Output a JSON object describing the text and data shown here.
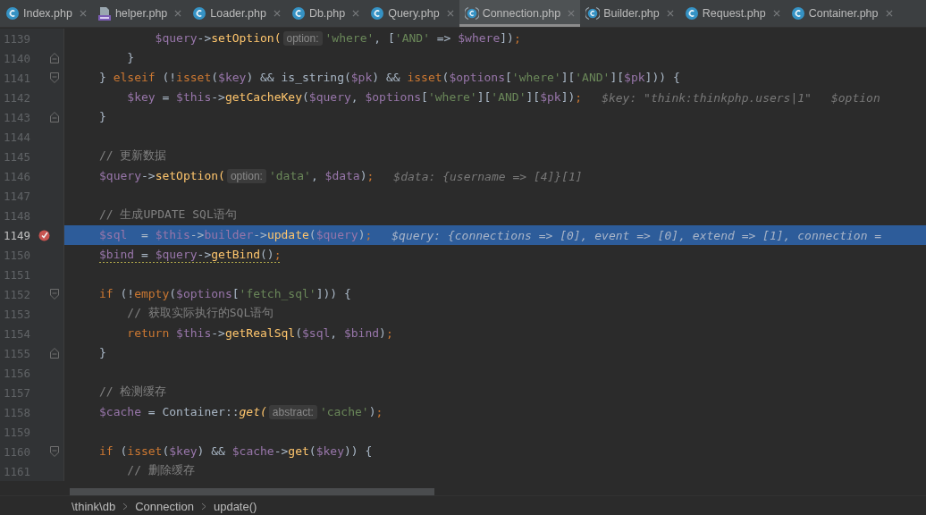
{
  "tabs": [
    {
      "label": "Index.php",
      "kind": "class",
      "selected": false
    },
    {
      "label": "helper.php",
      "kind": "php",
      "selected": false
    },
    {
      "label": "Loader.php",
      "kind": "class",
      "selected": false
    },
    {
      "label": "Db.php",
      "kind": "class",
      "selected": false
    },
    {
      "label": "Query.php",
      "kind": "class",
      "selected": false
    },
    {
      "label": "Connection.php",
      "kind": "class-bracketed",
      "selected": true
    },
    {
      "label": "Builder.php",
      "kind": "class-bracketed",
      "selected": false
    },
    {
      "label": "Request.php",
      "kind": "class",
      "selected": false
    },
    {
      "label": "Container.php",
      "kind": "class",
      "selected": false
    }
  ],
  "lines": [
    {
      "number": "1139",
      "breakpoint": false,
      "current": false,
      "segments": [
        {
          "kind": "code",
          "underline": false,
          "tokens": [
            {
              "kind": "var",
              "text": "        $query"
            },
            {
              "kind": "plain",
              "text": "->"
            },
            {
              "kind": "func",
              "text": "setOption("
            }
          ]
        },
        {
          "kind": "hint",
          "text": "option:"
        },
        {
          "kind": "code",
          "underline": false,
          "tokens": [
            {
              "kind": "string",
              "text": "'where'"
            },
            {
              "kind": "plain",
              "text": ", ["
            },
            {
              "kind": "string",
              "text": "'AND'"
            },
            {
              "kind": "plain",
              "text": " => "
            },
            {
              "kind": "var",
              "text": "$where"
            },
            {
              "kind": "plain",
              "text": "])"
            },
            {
              "kind": "keyword",
              "text": ";"
            }
          ]
        }
      ]
    },
    {
      "number": "1140",
      "fold": {
        "kind": "end"
      },
      "breakpoint": false,
      "current": false,
      "segments": [
        {
          "kind": "code",
          "underline": false,
          "tokens": [
            {
              "kind": "plain",
              "text": "    }"
            }
          ]
        }
      ]
    },
    {
      "number": "1141",
      "fold": {
        "kind": "start"
      },
      "breakpoint": false,
      "current": false,
      "segments": [
        {
          "kind": "code",
          "underline": false,
          "tokens": [
            {
              "kind": "plain",
              "text": "} "
            },
            {
              "kind": "keyword",
              "text": "elseif "
            },
            {
              "kind": "plain",
              "text": "(!"
            },
            {
              "kind": "keyword",
              "text": "isset"
            },
            {
              "kind": "plain",
              "text": "("
            },
            {
              "kind": "var",
              "text": "$key"
            },
            {
              "kind": "plain",
              "text": ") && is_string("
            },
            {
              "kind": "var",
              "text": "$pk"
            },
            {
              "kind": "plain",
              "text": ") && "
            },
            {
              "kind": "keyword",
              "text": "isset"
            },
            {
              "kind": "plain",
              "text": "("
            },
            {
              "kind": "var",
              "text": "$options"
            },
            {
              "kind": "plain",
              "text": "["
            },
            {
              "kind": "string",
              "text": "'where'"
            },
            {
              "kind": "plain",
              "text": "]["
            },
            {
              "kind": "string",
              "text": "'AND'"
            },
            {
              "kind": "plain",
              "text": "]["
            },
            {
              "kind": "var",
              "text": "$pk"
            },
            {
              "kind": "plain",
              "text": "])) {"
            }
          ]
        }
      ]
    },
    {
      "number": "1142",
      "breakpoint": false,
      "current": false,
      "segments": [
        {
          "kind": "code",
          "underline": false,
          "tokens": [
            {
              "kind": "var",
              "text": "    $key"
            },
            {
              "kind": "plain",
              "text": " = "
            },
            {
              "kind": "var",
              "text": "$this"
            },
            {
              "kind": "plain",
              "text": "->"
            },
            {
              "kind": "func",
              "text": "getCacheKey"
            },
            {
              "kind": "plain",
              "text": "("
            },
            {
              "kind": "var",
              "text": "$query"
            },
            {
              "kind": "plain",
              "text": ", "
            },
            {
              "kind": "var",
              "text": "$options"
            },
            {
              "kind": "plain",
              "text": "["
            },
            {
              "kind": "string",
              "text": "'where'"
            },
            {
              "kind": "plain",
              "text": "]["
            },
            {
              "kind": "string",
              "text": "'AND'"
            },
            {
              "kind": "plain",
              "text": "]["
            },
            {
              "kind": "var",
              "text": "$pk"
            },
            {
              "kind": "plain",
              "text": "])"
            },
            {
              "kind": "keyword",
              "text": ";"
            }
          ]
        },
        {
          "kind": "value",
          "text": "$key: \"think:thinkphp.users|1\""
        },
        {
          "kind": "value",
          "text": "$option"
        }
      ]
    },
    {
      "number": "1143",
      "fold": {
        "kind": "end"
      },
      "breakpoint": false,
      "current": false,
      "segments": [
        {
          "kind": "code",
          "underline": false,
          "tokens": [
            {
              "kind": "plain",
              "text": "}"
            }
          ]
        }
      ]
    },
    {
      "number": "1144",
      "breakpoint": false,
      "current": false
    },
    {
      "number": "1145",
      "breakpoint": false,
      "current": false,
      "segments": [
        {
          "kind": "code",
          "underline": false,
          "tokens": [
            {
              "kind": "comment",
              "text": "// 更新数据"
            }
          ]
        }
      ]
    },
    {
      "number": "1146",
      "breakpoint": false,
      "current": false,
      "segments": [
        {
          "kind": "code",
          "underline": false,
          "tokens": [
            {
              "kind": "var",
              "text": "$query"
            },
            {
              "kind": "plain",
              "text": "->"
            },
            {
              "kind": "func",
              "text": "setOption("
            }
          ]
        },
        {
          "kind": "hint",
          "text": "option:"
        },
        {
          "kind": "code",
          "underline": false,
          "tokens": [
            {
              "kind": "string",
              "text": "'data'"
            },
            {
              "kind": "plain",
              "text": ", "
            },
            {
              "kind": "var",
              "text": "$data"
            },
            {
              "kind": "plain",
              "text": ")"
            },
            {
              "kind": "keyword",
              "text": ";"
            }
          ]
        },
        {
          "kind": "value",
          "text": "$data: {username => [4]}[1]"
        }
      ]
    },
    {
      "number": "1147",
      "breakpoint": false,
      "current": false
    },
    {
      "number": "1148",
      "breakpoint": false,
      "current": false,
      "segments": [
        {
          "kind": "code",
          "underline": false,
          "tokens": [
            {
              "kind": "comment",
              "text": "// 生成UPDATE SQL语句"
            }
          ]
        }
      ]
    },
    {
      "number": "1149",
      "breakpoint": true,
      "current": true,
      "segments": [
        {
          "kind": "code",
          "underline": false,
          "tokens": [
            {
              "kind": "var",
              "text": "$sql"
            },
            {
              "kind": "plain",
              "text": "  = "
            },
            {
              "kind": "var",
              "text": "$this"
            },
            {
              "kind": "plain",
              "text": "->"
            },
            {
              "kind": "var",
              "text": "builder"
            },
            {
              "kind": "plain",
              "text": "->"
            },
            {
              "kind": "func",
              "text": "update"
            },
            {
              "kind": "plain",
              "text": "("
            },
            {
              "kind": "var",
              "text": "$query"
            },
            {
              "kind": "plain",
              "text": ")"
            },
            {
              "kind": "keyword",
              "text": ";"
            }
          ]
        },
        {
          "kind": "value",
          "text": "$query: {connections => [0], event => [0], extend => [1], connection ="
        }
      ]
    },
    {
      "number": "1150",
      "breakpoint": false,
      "current": false,
      "segments": [
        {
          "kind": "code",
          "underline": true,
          "tokens": [
            {
              "kind": "var",
              "text": "$bind"
            },
            {
              "kind": "plain",
              "text": " = "
            },
            {
              "kind": "var",
              "text": "$query"
            },
            {
              "kind": "plain",
              "text": "->"
            },
            {
              "kind": "func",
              "text": "getBind"
            },
            {
              "kind": "plain",
              "text": "()"
            },
            {
              "kind": "keyword",
              "text": ";"
            }
          ]
        }
      ]
    },
    {
      "number": "1151",
      "breakpoint": false,
      "current": false
    },
    {
      "number": "1152",
      "fold": {
        "kind": "start"
      },
      "breakpoint": false,
      "current": false,
      "segments": [
        {
          "kind": "code",
          "underline": false,
          "tokens": [
            {
              "kind": "keyword",
              "text": "if "
            },
            {
              "kind": "plain",
              "text": "(!"
            },
            {
              "kind": "keyword",
              "text": "empty"
            },
            {
              "kind": "plain",
              "text": "("
            },
            {
              "kind": "var",
              "text": "$options"
            },
            {
              "kind": "plain",
              "text": "["
            },
            {
              "kind": "string",
              "text": "'fetch_sql'"
            },
            {
              "kind": "plain",
              "text": "])) {"
            }
          ]
        }
      ]
    },
    {
      "number": "1153",
      "breakpoint": false,
      "current": false,
      "segments": [
        {
          "kind": "code",
          "underline": false,
          "tokens": [
            {
              "kind": "comment",
              "text": "    // 获取实际执行的SQL语句"
            }
          ]
        }
      ]
    },
    {
      "number": "1154",
      "breakpoint": false,
      "current": false,
      "segments": [
        {
          "kind": "code",
          "underline": false,
          "tokens": [
            {
              "kind": "keyword",
              "text": "    return "
            },
            {
              "kind": "var",
              "text": "$this"
            },
            {
              "kind": "plain",
              "text": "->"
            },
            {
              "kind": "func",
              "text": "getRealSql"
            },
            {
              "kind": "plain",
              "text": "("
            },
            {
              "kind": "var",
              "text": "$sql"
            },
            {
              "kind": "plain",
              "text": ", "
            },
            {
              "kind": "var",
              "text": "$bind"
            },
            {
              "kind": "plain",
              "text": ")"
            },
            {
              "kind": "keyword",
              "text": ";"
            }
          ]
        }
      ]
    },
    {
      "number": "1155",
      "fold": {
        "kind": "end"
      },
      "breakpoint": false,
      "current": false,
      "segments": [
        {
          "kind": "code",
          "underline": false,
          "tokens": [
            {
              "kind": "plain",
              "text": "}"
            }
          ]
        }
      ]
    },
    {
      "number": "1156",
      "breakpoint": false,
      "current": false
    },
    {
      "number": "1157",
      "breakpoint": false,
      "current": false,
      "segments": [
        {
          "kind": "code",
          "underline": false,
          "tokens": [
            {
              "kind": "comment",
              "text": "// 检测缓存"
            }
          ]
        }
      ]
    },
    {
      "number": "1158",
      "breakpoint": false,
      "current": false,
      "segments": [
        {
          "kind": "code",
          "underline": false,
          "tokens": [
            {
              "kind": "var",
              "text": "$cache"
            },
            {
              "kind": "plain",
              "text": " = Container::"
            },
            {
              "kind": "static",
              "text": "get("
            }
          ]
        },
        {
          "kind": "hint",
          "text": "abstract:"
        },
        {
          "kind": "code",
          "underline": false,
          "tokens": [
            {
              "kind": "string",
              "text": "'cache'"
            },
            {
              "kind": "plain",
              "text": ")"
            },
            {
              "kind": "keyword",
              "text": ";"
            }
          ]
        }
      ]
    },
    {
      "number": "1159",
      "breakpoint": false,
      "current": false
    },
    {
      "number": "1160",
      "fold": {
        "kind": "start"
      },
      "breakpoint": false,
      "current": false,
      "segments": [
        {
          "kind": "code",
          "underline": false,
          "tokens": [
            {
              "kind": "keyword",
              "text": "if "
            },
            {
              "kind": "plain",
              "text": "("
            },
            {
              "kind": "keyword",
              "text": "isset"
            },
            {
              "kind": "plain",
              "text": "("
            },
            {
              "kind": "var",
              "text": "$key"
            },
            {
              "kind": "plain",
              "text": ") && "
            },
            {
              "kind": "var",
              "text": "$cache"
            },
            {
              "kind": "plain",
              "text": "->"
            },
            {
              "kind": "func",
              "text": "get"
            },
            {
              "kind": "plain",
              "text": "("
            },
            {
              "kind": "var",
              "text": "$key"
            },
            {
              "kind": "plain",
              "text": ")) {"
            }
          ]
        }
      ]
    },
    {
      "number": "1161",
      "breakpoint": false,
      "current": false,
      "segments": [
        {
          "kind": "code",
          "underline": false,
          "tokens": [
            {
              "kind": "comment",
              "text": "    // 删除缓存"
            }
          ]
        }
      ]
    }
  ],
  "breadcrumb": [
    "\\think\\db",
    "Connection",
    "update()"
  ]
}
